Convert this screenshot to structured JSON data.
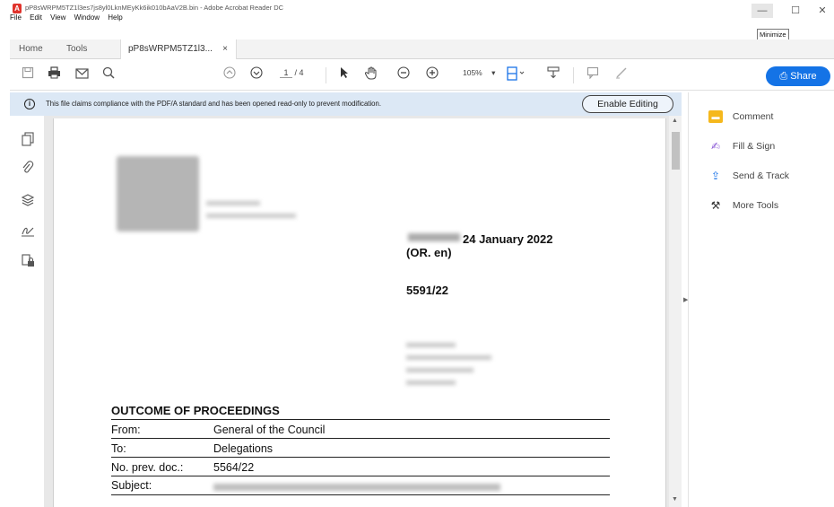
{
  "window": {
    "title": "pP8sWRPM5TZ1l3es7js8yl0LknMEyKk6ik010bAaV2B.bin - Adobe Acrobat Reader DC",
    "minimize_glyph": "—",
    "maximize_glyph": "☐",
    "close_glyph": "✕",
    "tooltip": "Minimize"
  },
  "menu": [
    "File",
    "Edit",
    "View",
    "Window",
    "Help"
  ],
  "tabs": {
    "home": "Home",
    "tools": "Tools",
    "doc": "pP8sWRPM5TZ1l3...",
    "doc_close": "×"
  },
  "toolbar": {
    "page_current": "1",
    "page_total": "/ 4",
    "zoom": "105%",
    "zoom_caret": "▾",
    "share_label": "Share"
  },
  "notice": {
    "text": "This file claims compliance with the PDF/A standard and has been opened read-only to prevent modification.",
    "button": "Enable Editing"
  },
  "document": {
    "date": "24 January 2022",
    "origin": "(OR. en)",
    "number": "5591/22",
    "section_title": "OUTCOME OF PROCEEDINGS",
    "rows": [
      {
        "label": "From:",
        "value": "General of the Council"
      },
      {
        "label": "To:",
        "value": "Delegations"
      },
      {
        "label": "No. prev. doc.:",
        "value": "5564/22"
      },
      {
        "label": "Subject:",
        "value": ""
      }
    ]
  },
  "right_panel": {
    "items": [
      {
        "label": "Comment",
        "icon": "comment-icon"
      },
      {
        "label": "Fill & Sign",
        "icon": "fill-sign-icon"
      },
      {
        "label": "Send & Track",
        "icon": "send-track-icon"
      },
      {
        "label": "More Tools",
        "icon": "more-tools-icon"
      }
    ]
  },
  "colors": {
    "share_button": "#1473e6",
    "notice_bar": "#dce8f5",
    "acrobat_red": "#e0332c"
  }
}
